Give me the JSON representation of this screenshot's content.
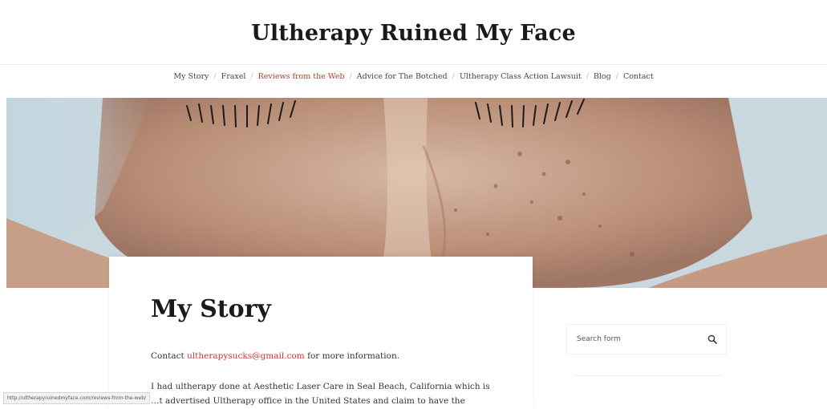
{
  "site": {
    "title": "Ultherapy Ruined My Face"
  },
  "nav": {
    "items": [
      {
        "label": "My Story"
      },
      {
        "label": "Fraxel"
      },
      {
        "label": "Reviews from the Web",
        "active": true
      },
      {
        "label": "Advice for The Botched"
      },
      {
        "label": "Ultherapy Class Action Lawsuit"
      },
      {
        "label": "Blog"
      },
      {
        "label": "Contact"
      }
    ],
    "separator": "/",
    "active_color": "#c0392b"
  },
  "hero": {
    "image": "face-closeup-with-damaged-skin"
  },
  "article": {
    "title": "My Story",
    "contact_prefix": "Contact",
    "contact_email": "ultherapysucks@gmail.com",
    "contact_suffix": "for more information.",
    "paragraph_line1": "I had ultherapy done at Aesthetic Laser Care in Seal Beach, California which is",
    "paragraph_line2": "…t advertised Ultherapy office in the United States and claim to have the"
  },
  "sidebar": {
    "search_placeholder": "Search form",
    "search_icon": "search-icon"
  },
  "status_bar": {
    "url": "http://ultherapyruinedmyface.com/reviews-from-the-web/"
  },
  "colors": {
    "accent": "#c0392b",
    "text": "#222222"
  }
}
